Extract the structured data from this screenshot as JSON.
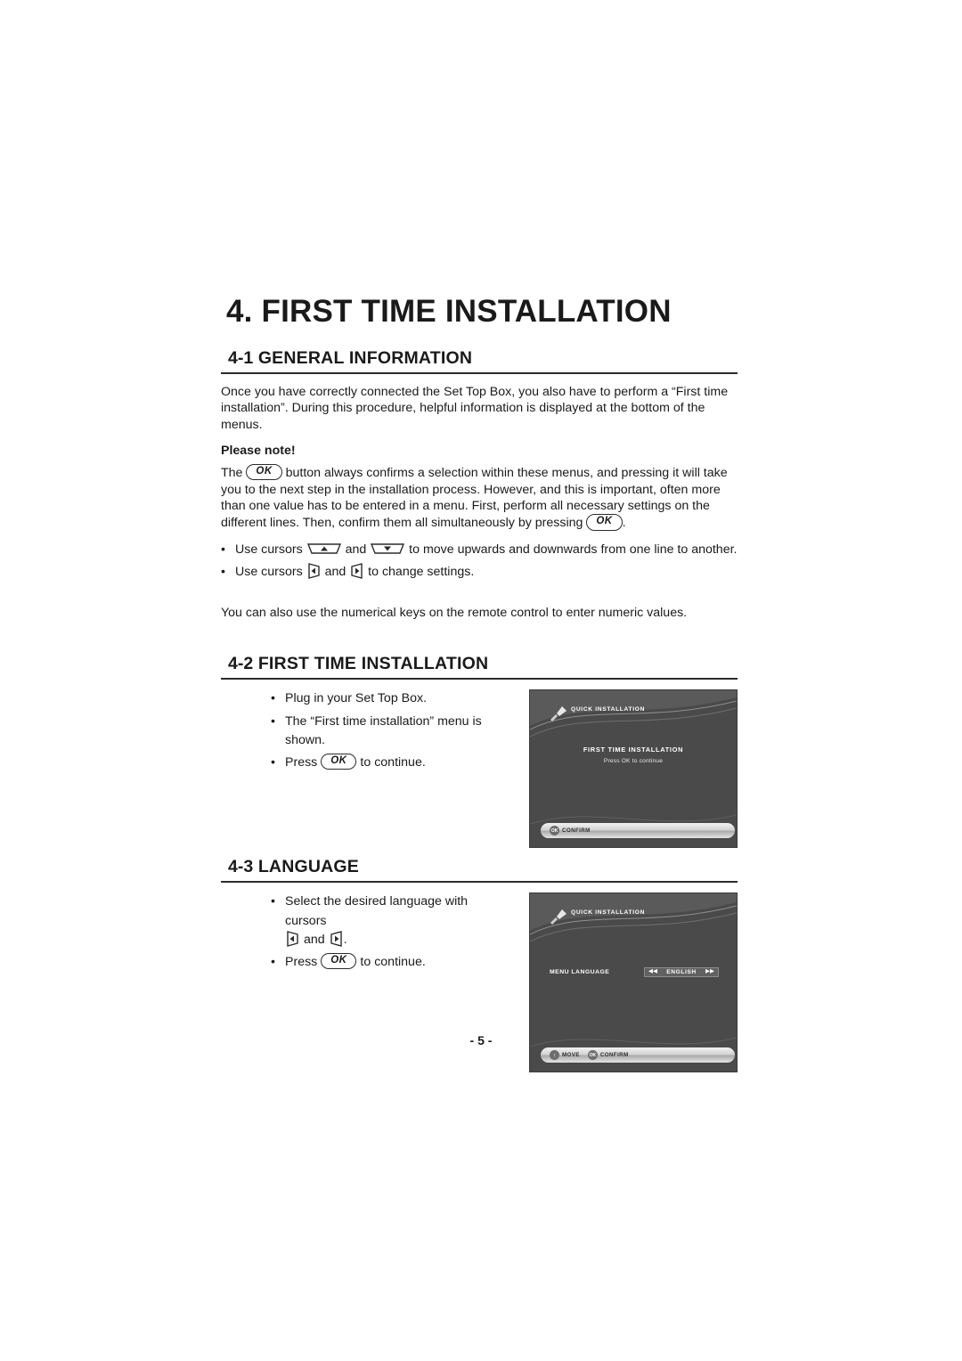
{
  "document": {
    "chapter_title": "4. FIRST TIME INSTALLATION",
    "page_number": "- 5 -"
  },
  "section_general": {
    "number": "4-1",
    "title": "GENERAL INFORMATION",
    "paragraph_1": "Once you have correctly connected the Set Top Box, you also have to perform a “First time installation”. During this procedure, helpful information is displayed at the bottom of the menus.",
    "note_label": "Please note!",
    "para_2_part1": "The",
    "para_2_part2": "button always confirms a selection within these menus, and pressing it will take you to the next step in the installation process. However, and this is important, often more than one value has to be entered in a menu. First, perform all necessary settings on the different lines. Then, confirm them all simultaneously by pressing",
    "para_2_part3": ".",
    "ok_label": "OK",
    "bullets": [
      {
        "pre": "Use cursors",
        "mid": "and",
        "post": "to move upwards and downwards from one line to another."
      },
      {
        "pre": "Use cursors",
        "mid": "and",
        "post": "to change settings."
      }
    ],
    "paragraph_3": "You can also use the numerical keys on the remote control to enter numeric values."
  },
  "section_fti": {
    "number": "4-2",
    "title": "FIRST TIME INSTALLATION",
    "bullets": [
      "Plug in your Set Top Box.",
      "The “First time installation” menu is shown."
    ],
    "press_pre": "Press",
    "press_post": "to continue.",
    "ok_label": "OK",
    "screen": {
      "header": "QUICK INSTALLATION",
      "title": "FIRST TIME INSTALLATION",
      "subtitle": "Press OK to continue",
      "bottom_bar": [
        {
          "icon": "OK",
          "label": "CONFIRM"
        }
      ]
    }
  },
  "section_language": {
    "number": "4-3",
    "title": "LANGUAGE",
    "bullet_1": "Select the desired language with cursors",
    "and_word": "and",
    "period": ".",
    "press_pre": "Press",
    "press_post": "to continue.",
    "ok_label": "OK",
    "screen": {
      "header": "QUICK INSTALLATION",
      "menu_label": "MENU LANGUAGE",
      "menu_value": "ENGLISH",
      "bottom_bar": [
        {
          "icon": "↕",
          "label": "MOVE"
        },
        {
          "icon": "OK",
          "label": "CONFIRM"
        }
      ]
    }
  }
}
